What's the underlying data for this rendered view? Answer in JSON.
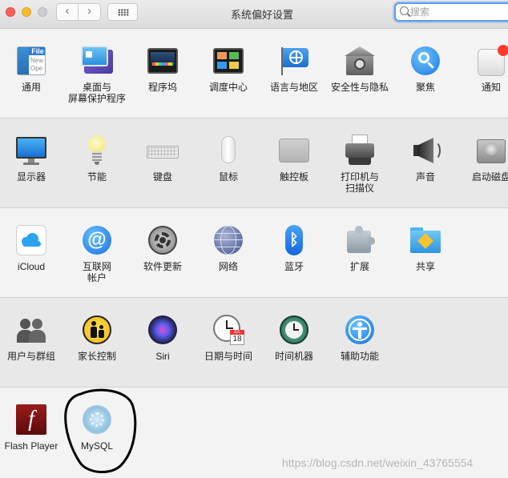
{
  "window": {
    "title": "系统偏好设置",
    "search_placeholder": "搜索"
  },
  "colors": {
    "accent": "#5b9ce8",
    "close": "#fc5f57",
    "minimize": "#fdbc2e",
    "zoom_disabled": "#cdcdcd",
    "badge": "#ff3b30"
  },
  "rows": [
    {
      "panes": [
        {
          "label": "通用",
          "icon": "general-icon"
        },
        {
          "label": "桌面与\n屏幕保护程序",
          "icon": "desktop-screensaver-icon"
        },
        {
          "label": "程序坞",
          "icon": "dock-icon"
        },
        {
          "label": "调度中心",
          "icon": "mission-control-icon"
        },
        {
          "label": "语言与地区",
          "icon": "language-region-icon"
        },
        {
          "label": "安全性与隐私",
          "icon": "security-privacy-icon"
        },
        {
          "label": "聚焦",
          "icon": "spotlight-icon"
        },
        {
          "label": "通知",
          "icon": "notifications-icon"
        }
      ]
    },
    {
      "panes": [
        {
          "label": "显示器",
          "icon": "displays-icon"
        },
        {
          "label": "节能",
          "icon": "energy-saver-icon"
        },
        {
          "label": "键盘",
          "icon": "keyboard-icon"
        },
        {
          "label": "鼠标",
          "icon": "mouse-icon"
        },
        {
          "label": "触控板",
          "icon": "trackpad-icon"
        },
        {
          "label": "打印机与\n扫描仪",
          "icon": "printers-scanners-icon"
        },
        {
          "label": "声音",
          "icon": "sound-icon"
        },
        {
          "label": "启动磁盘",
          "icon": "startup-disk-icon"
        }
      ]
    },
    {
      "panes": [
        {
          "label": "iCloud",
          "icon": "icloud-icon"
        },
        {
          "label": "互联网\n帐户",
          "icon": "internet-accounts-icon"
        },
        {
          "label": "软件更新",
          "icon": "software-update-icon"
        },
        {
          "label": "网络",
          "icon": "network-icon"
        },
        {
          "label": "蓝牙",
          "icon": "bluetooth-icon"
        },
        {
          "label": "扩展",
          "icon": "extensions-icon"
        },
        {
          "label": "共享",
          "icon": "sharing-icon"
        }
      ]
    },
    {
      "panes": [
        {
          "label": "用户与群组",
          "icon": "users-groups-icon"
        },
        {
          "label": "家长控制",
          "icon": "parental-controls-icon"
        },
        {
          "label": "Siri",
          "icon": "siri-icon"
        },
        {
          "label": "日期与时间",
          "icon": "date-time-icon"
        },
        {
          "label": "时间机器",
          "icon": "time-machine-icon"
        },
        {
          "label": "辅助功能",
          "icon": "accessibility-icon"
        }
      ]
    },
    {
      "panes": [
        {
          "label": "Flash Player",
          "icon": "flash-player-icon"
        },
        {
          "label": "MySQL",
          "icon": "mysql-icon"
        }
      ]
    }
  ],
  "icon_text": {
    "general_file": "File",
    "general_new": "New",
    "general_ope": "Ope",
    "calendar_month": "JUL",
    "calendar_day": "18",
    "flash_glyph": "f"
  },
  "watermark": "https://blog.csdn.net/weixin_43765554"
}
